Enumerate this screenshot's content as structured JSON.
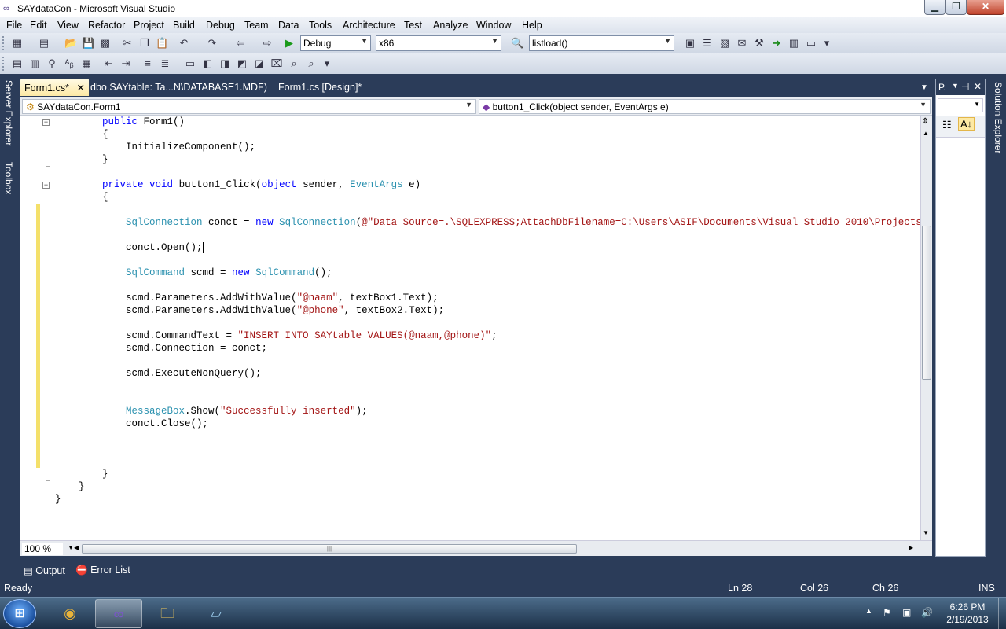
{
  "window": {
    "title": "SAYdataCon - Microsoft Visual Studio"
  },
  "menu": [
    "File",
    "Edit",
    "View",
    "Refactor",
    "Project",
    "Build",
    "Debug",
    "Team",
    "Data",
    "Tools",
    "Architecture",
    "Test",
    "Analyze",
    "Window",
    "Help"
  ],
  "toolbar": {
    "config": "Debug",
    "platform": "x86",
    "find": "listload()"
  },
  "side_tabs": {
    "server_explorer": "Server Explorer",
    "toolbox": "Toolbox",
    "solution_explorer": "Solution Explorer"
  },
  "doc_tabs": [
    {
      "label": "Form1.cs*",
      "active": true
    },
    {
      "label": "dbo.SAYtable: Ta...N\\DATABASE1.MDF)",
      "active": false
    },
    {
      "label": "Form1.cs [Design]*",
      "active": false
    }
  ],
  "nav": {
    "class_combo": "SAYdataCon.Form1",
    "member_combo": "button1_Click(object sender, EventArgs e)"
  },
  "code_lines": [
    "        public Form1()",
    "        {",
    "            InitializeComponent();",
    "        }",
    "",
    "        private void button1_Click(object sender, EventArgs e)",
    "        {",
    "",
    "            SqlConnection conct = new SqlConnection(@\"Data Source=.\\SQLEXPRESS;AttachDbFilename=C:\\Users\\ASIF\\Documents\\Visual Studio 2010\\Projects\\SAYdatabas",
    "",
    "            conct.Open();",
    "",
    "            SqlCommand scmd = new SqlCommand();",
    "",
    "            scmd.Parameters.AddWithValue(\"@naam\", textBox1.Text);",
    "            scmd.Parameters.AddWithValue(\"@phone\", textBox2.Text);",
    "",
    "            scmd.CommandText = \"INSERT INTO SAYtable VALUES(@naam,@phone)\";",
    "            scmd.Connection = conct;",
    "",
    "            scmd.ExecuteNonQuery();",
    "",
    "",
    "            MessageBox.Show(\"Successfully inserted\");",
    "            conct.Close();",
    "",
    "",
    "",
    "        }",
    "    }",
    "}"
  ],
  "zoom": "100 %",
  "properties_panel": {
    "title": "P."
  },
  "bottom_tabs": [
    "Output",
    "Error List"
  ],
  "status": {
    "left": "Ready",
    "line": "Ln 28",
    "col": "Col 26",
    "ch": "Ch 26",
    "mode": "INS"
  },
  "clock": {
    "time": "6:26 PM",
    "date": "2/19/2013"
  },
  "colors": {
    "keyword": "#0000ff",
    "type": "#2b91af",
    "string": "#a31515",
    "chrome": "#2b3c59"
  }
}
